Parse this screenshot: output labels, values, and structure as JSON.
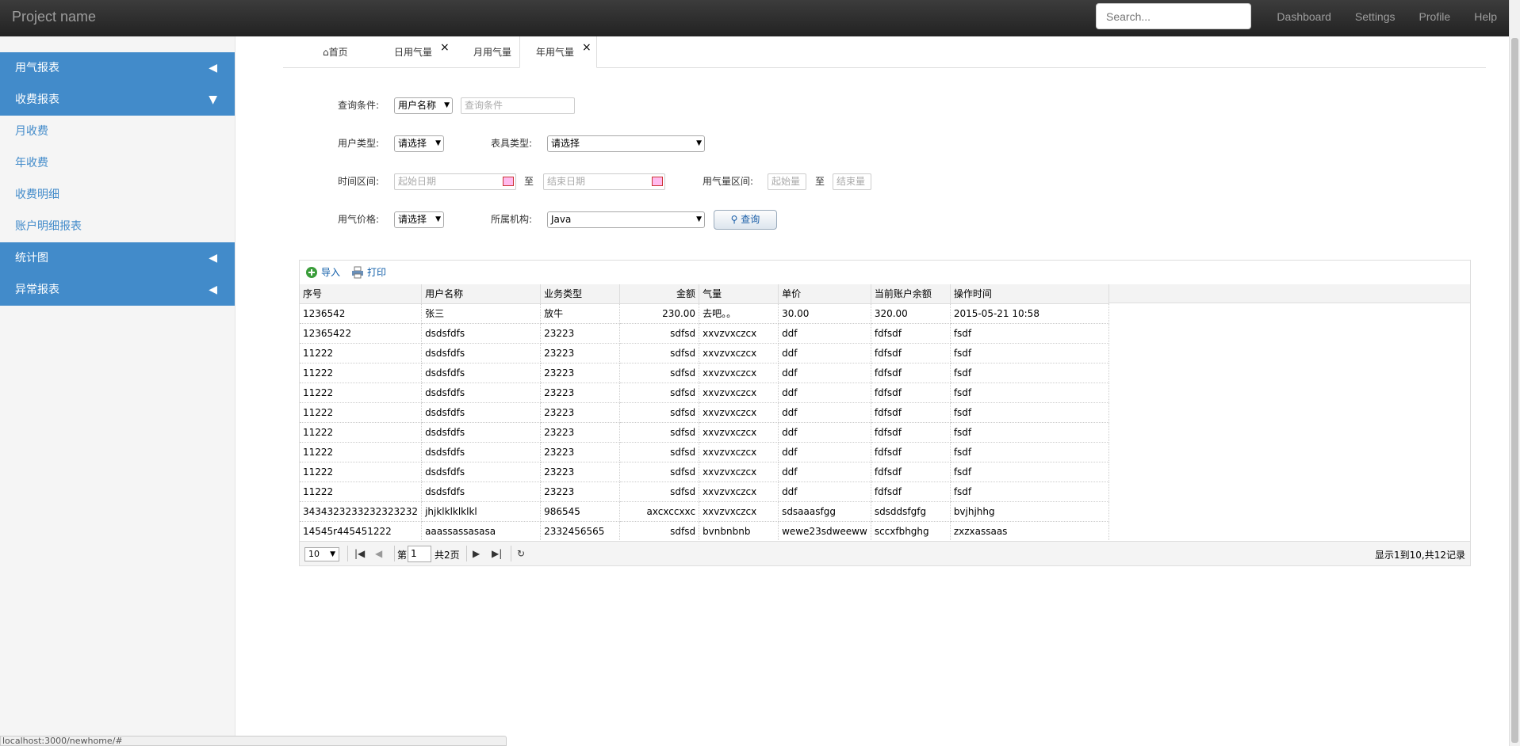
{
  "navbar": {
    "brand": "Project name",
    "search_placeholder": "Search...",
    "links": [
      "Dashboard",
      "Settings",
      "Profile",
      "Help"
    ]
  },
  "sidebar": {
    "groups": [
      {
        "label": "用气报表",
        "arrow": "◀"
      },
      {
        "label": "收费报表",
        "arrow": "▼"
      },
      {
        "label": "统计图",
        "arrow": "◀"
      },
      {
        "label": "异常报表",
        "arrow": "◀"
      }
    ],
    "sub_items": [
      "月收费",
      "年收费",
      "收费明细",
      "账户明细报表"
    ]
  },
  "tabs": [
    {
      "label": "首页"
    },
    {
      "label": "日用气量"
    },
    {
      "label": "月用气量"
    },
    {
      "label": "年用气量"
    }
  ],
  "form": {
    "query_label": "查询条件:",
    "query_select": "用户名称",
    "query_placeholder": "查询条件",
    "user_type_label": "用户类型:",
    "user_type_value": "请选择",
    "meter_type_label": "表具类型:",
    "meter_type_value": "请选择",
    "time_label": "时间区间:",
    "start_date_placeholder": "起始日期",
    "to1": "至",
    "end_date_placeholder": "结束日期",
    "gas_range_label": "用气量区间:",
    "start_amount_placeholder": "起始量",
    "to2": "至",
    "end_amount_placeholder": "结束量",
    "price_label": "用气价格:",
    "price_value": "请选择",
    "org_label": "所属机构:",
    "org_value": "Java",
    "search_button": "查询"
  },
  "grid": {
    "toolbar": {
      "import": "导入",
      "print": "打印"
    },
    "columns": [
      "序号",
      "用户名称",
      "业务类型",
      "金额",
      "气量",
      "单价",
      "当前账户余额",
      "操作时间"
    ],
    "rows": [
      [
        "1236542",
        "张三",
        "放牛",
        "230.00",
        "去吧。。",
        "30.00",
        "320.00",
        "2015-05-21 10:58"
      ],
      [
        "12365422",
        "dsdsfdfs",
        "23223",
        "sdfsd",
        "xxvzvxczcx",
        "ddf",
        "fdfsdf",
        "fsdf"
      ],
      [
        "11222",
        "dsdsfdfs",
        "23223",
        "sdfsd",
        "xxvzvxczcx",
        "ddf",
        "fdfsdf",
        "fsdf"
      ],
      [
        "11222",
        "dsdsfdfs",
        "23223",
        "sdfsd",
        "xxvzvxczcx",
        "ddf",
        "fdfsdf",
        "fsdf"
      ],
      [
        "11222",
        "dsdsfdfs",
        "23223",
        "sdfsd",
        "xxvzvxczcx",
        "ddf",
        "fdfsdf",
        "fsdf"
      ],
      [
        "11222",
        "dsdsfdfs",
        "23223",
        "sdfsd",
        "xxvzvxczcx",
        "ddf",
        "fdfsdf",
        "fsdf"
      ],
      [
        "11222",
        "dsdsfdfs",
        "23223",
        "sdfsd",
        "xxvzvxczcx",
        "ddf",
        "fdfsdf",
        "fsdf"
      ],
      [
        "11222",
        "dsdsfdfs",
        "23223",
        "sdfsd",
        "xxvzvxczcx",
        "ddf",
        "fdfsdf",
        "fsdf"
      ],
      [
        "11222",
        "dsdsfdfs",
        "23223",
        "sdfsd",
        "xxvzvxczcx",
        "ddf",
        "fdfsdf",
        "fsdf"
      ],
      [
        "11222",
        "dsdsfdfs",
        "23223",
        "sdfsd",
        "xxvzvxczcx",
        "ddf",
        "fdfsdf",
        "fsdf"
      ],
      [
        "3434323233232323232",
        "jhjklklklklkl",
        "986545",
        "axcxccxxc",
        "xxvzvxczcx",
        "sdsaaasfgg",
        "sdsddsfgfg",
        "bvjhjhhg"
      ],
      [
        "14545r445451222",
        "aaassassasasa",
        "2332456565",
        "sdfsd",
        "bvnbnbnb",
        "wewe23sdweeww",
        "sccxfbhghg",
        "zxzxassaas"
      ]
    ],
    "pager": {
      "page_size": "10",
      "page_prefix": "第",
      "page_value": "1",
      "page_total": "共2页",
      "summary": "显示1到10,共12记录"
    }
  },
  "status_bar": "localhost:3000/newhome/#",
  "colors": {
    "sidebar_accent": "#428bca",
    "navbar": "#222222"
  }
}
